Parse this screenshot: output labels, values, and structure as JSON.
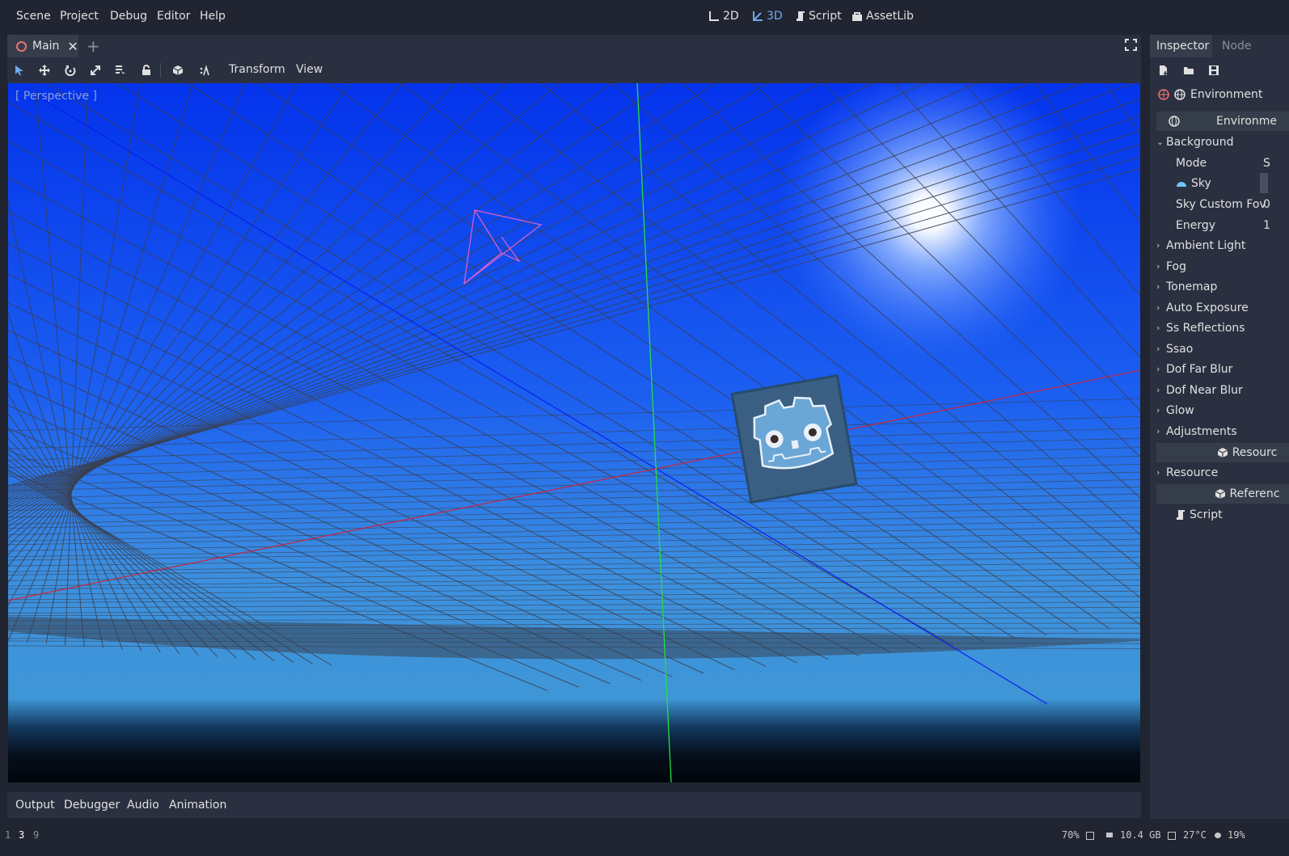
{
  "menu": {
    "scene": "Scene",
    "project": "Project",
    "debug": "Debug",
    "editor": "Editor",
    "help": "Help"
  },
  "workspaces": {
    "two_d": "2D",
    "three_d": "3D",
    "script": "Script",
    "assetlib": "AssetLib"
  },
  "scene_tabs": {
    "main": "Main",
    "add": "+"
  },
  "toolbar": {
    "transform": "Transform",
    "view": "View"
  },
  "viewport": {
    "label": "[ Perspective ]"
  },
  "bottom_tabs": {
    "output": "Output",
    "debugger": "Debugger",
    "audio": "Audio",
    "animation": "Animation"
  },
  "dock_tabs": {
    "inspector": "Inspector",
    "node": "Node"
  },
  "inspector": {
    "resource": "Environment",
    "sections": {
      "environment": "Environme",
      "resource": "Resourc",
      "reference": "Referenc"
    },
    "props": {
      "background": "Background",
      "mode": "Mode",
      "mode_value": "S",
      "sky": "Sky",
      "sky_custom_fov": "Sky Custom Fov",
      "sky_custom_fov_value": "0",
      "energy": "Energy",
      "energy_value": "1",
      "ambient_light": "Ambient Light",
      "fog": "Fog",
      "tonemap": "Tonemap",
      "auto_exposure": "Auto Exposure",
      "ss_reflections": "Ss Reflections",
      "ssao": "Ssao",
      "dof_far_blur": "Dof Far Blur",
      "dof_near_blur": "Dof Near Blur",
      "glow": "Glow",
      "adjustments": "Adjustments",
      "resource": "Resource",
      "script": "Script"
    }
  },
  "statusbar": {
    "ws1": "1",
    "ws2": "3",
    "ws3": "9",
    "cpu": "70%",
    "mem": "10.4 GB",
    "temp": "27°C",
    "bat": "19%"
  },
  "colors": {
    "accent": "#6fa9f0",
    "panel": "#2a3040",
    "bg": "#202531"
  }
}
